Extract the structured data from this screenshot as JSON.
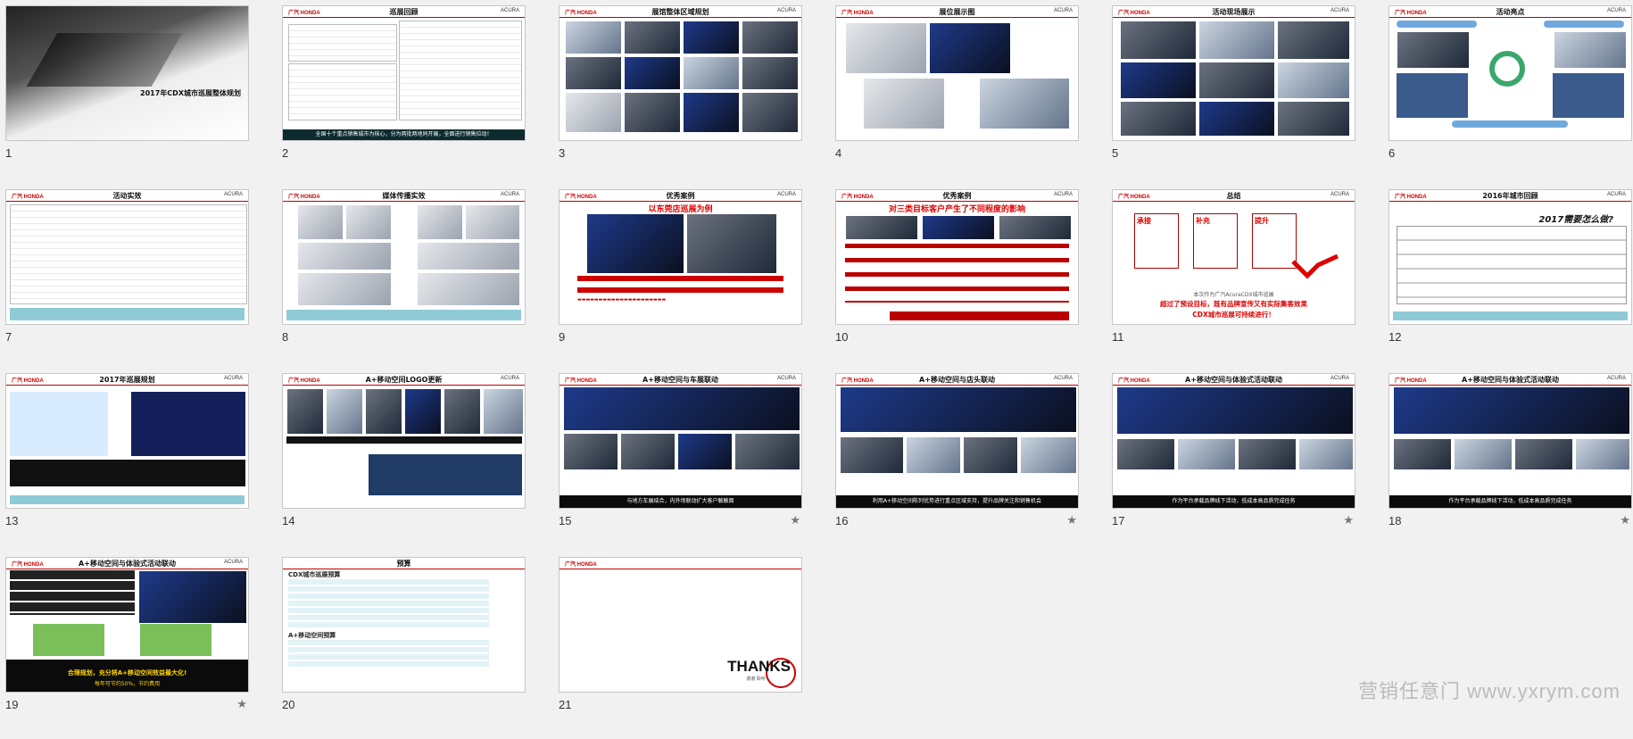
{
  "slides": [
    {
      "n": "1",
      "star": "",
      "title": "2017年CDX城市巡展整体规划"
    },
    {
      "n": "2",
      "star": "",
      "title": "巡展回顾",
      "footer": "全国十个重点销售城市为核心，分为两批两地同开展，全面进行销售拉动！"
    },
    {
      "n": "3",
      "star": "",
      "title": "展馆整体区域规划"
    },
    {
      "n": "4",
      "star": "",
      "title": "展位展示图"
    },
    {
      "n": "5",
      "star": "",
      "title": "活动现场展示"
    },
    {
      "n": "6",
      "star": "",
      "title": "活动亮点"
    },
    {
      "n": "7",
      "star": "",
      "title": "活动实效"
    },
    {
      "n": "8",
      "star": "",
      "title": "媒体传播实效"
    },
    {
      "n": "9",
      "star": "",
      "title": "优秀案例",
      "subtitle": "以东莞店巡展为例"
    },
    {
      "n": "10",
      "star": "",
      "title": "优秀案例",
      "subtitle": "对三类目标客户产生了不同程度的影响"
    },
    {
      "n": "11",
      "star": "",
      "title": "总结",
      "boxes": [
        "承接",
        "补充",
        "提升"
      ],
      "line1": "本次作为广汽AcuraCDX城市巡展",
      "line2": "超过了预设目标，既有品牌宣传又有实际集客效果",
      "line3": "CDX城市巡展可持续进行！"
    },
    {
      "n": "12",
      "star": "",
      "title": "2016年城市回顾",
      "heading": "2017需要怎么做?"
    },
    {
      "n": "13",
      "star": "",
      "title": "2017年巡展规划"
    },
    {
      "n": "14",
      "star": "",
      "title": "A+移动空间LOGO更新"
    },
    {
      "n": "15",
      "star": "★",
      "title": "A+移动空间与车展联动",
      "footer": "与地方车展结合，内外场联动扩大客户触触面"
    },
    {
      "n": "16",
      "star": "★",
      "title": "A+移动空间与店头联动",
      "footer": "利用A+移动空间陈列优势进行重点区域支持，提升品牌关注和销售机会"
    },
    {
      "n": "17",
      "star": "★",
      "title": "A+移动空间与体验式活动联动",
      "footer": "作为平台承载品牌线下活动，低成本高品质完成任务"
    },
    {
      "n": "18",
      "star": "★",
      "title": "A+移动空间与体验式活动联动",
      "footer": "作为平台承载品牌线下活动，低成本高品质完成任务"
    },
    {
      "n": "19",
      "star": "★",
      "title": "A+移动空间与体验式活动联动",
      "footer1": "合理规划，充分将A+移动空间效益最大化!",
      "footer2": "每年可节约50%，节约费用"
    },
    {
      "n": "20",
      "star": "",
      "title": "预算",
      "sub1": "CDX城市巡展预算",
      "sub2": "A+移动空间预算"
    },
    {
      "n": "21",
      "star": "",
      "title": "",
      "thanks": "THANKS",
      "thanks_sub": "谢谢 聆听"
    }
  ],
  "watermark": "营销任意门 www.yxrym.com",
  "colors": {
    "accent": "#c00000",
    "dark_band": "#0d2b2f",
    "background": "#f1f1f1"
  }
}
